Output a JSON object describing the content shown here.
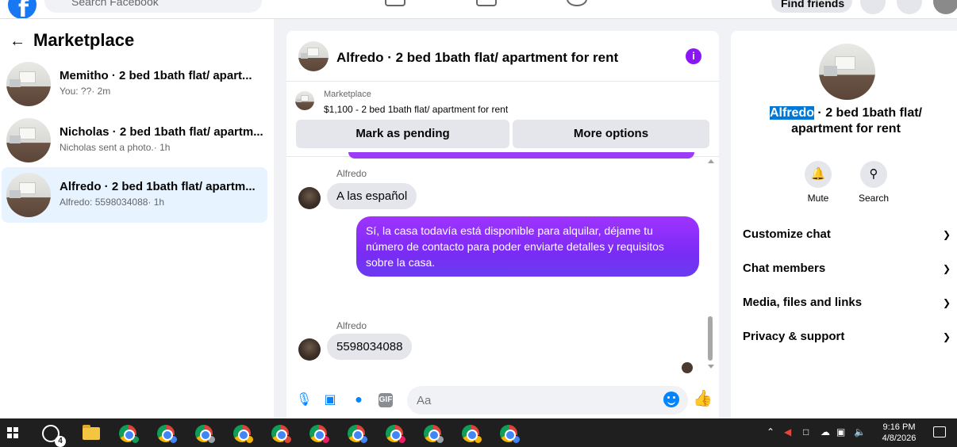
{
  "topbar": {
    "search_placeholder": "Search Facebook",
    "find_friends": "Find friends"
  },
  "marketplace": {
    "title": "Marketplace",
    "conversations": [
      {
        "title": "Memitho · 2 bed 1bath flat/ apart...",
        "subtitle": "You: ??· 2m",
        "active": false
      },
      {
        "title": "Nicholas · 2 bed 1bath flat/ apartm...",
        "subtitle": "Nicholas sent a photo.· 1h",
        "active": false
      },
      {
        "title": "Alfredo · 2 bed 1bath flat/ apartm...",
        "subtitle": "Alfredo: 5598034088· 1h",
        "active": true
      }
    ]
  },
  "chat": {
    "title": "Alfredo · 2 bed 1bath flat/ apartment for rent",
    "info_icon": "i",
    "listing_label": "Marketplace",
    "listing_price": "$1,100 - 2 bed 1bath flat/ apartment for rent",
    "mark_pending": "Mark as pending",
    "more_options": "More options",
    "messages": [
      {
        "sender": "Alfredo",
        "text": "A las español",
        "direction": "in"
      },
      {
        "sender": "",
        "text": "Sí, la casa todavía está disponible para alquilar, déjame tu número de contacto para poder enviarte detalles y requisitos sobre la casa.",
        "direction": "out"
      },
      {
        "sender": "Alfredo",
        "text": "5598034088",
        "direction": "in"
      }
    ],
    "composer_placeholder": "Aa"
  },
  "details": {
    "title_highlight": "Alfredo",
    "title_rest": " · 2 bed 1bath flat/ apartment for rent",
    "actions": [
      {
        "label": "Mute",
        "icon": "bell-icon"
      },
      {
        "label": "Search",
        "icon": "search-icon"
      }
    ],
    "sections": [
      "Customize chat",
      "Chat members",
      "Media, files and links",
      "Privacy & support"
    ]
  },
  "taskbar": {
    "whatsapp_badge": "4",
    "time": "9:16 PM",
    "date": "4/8/2026"
  },
  "colors": {
    "facebook_blue": "#1877f2",
    "messenger_purple": "#8a15f5",
    "active_row": "#e7f3ff",
    "selection": "#0078d7"
  }
}
